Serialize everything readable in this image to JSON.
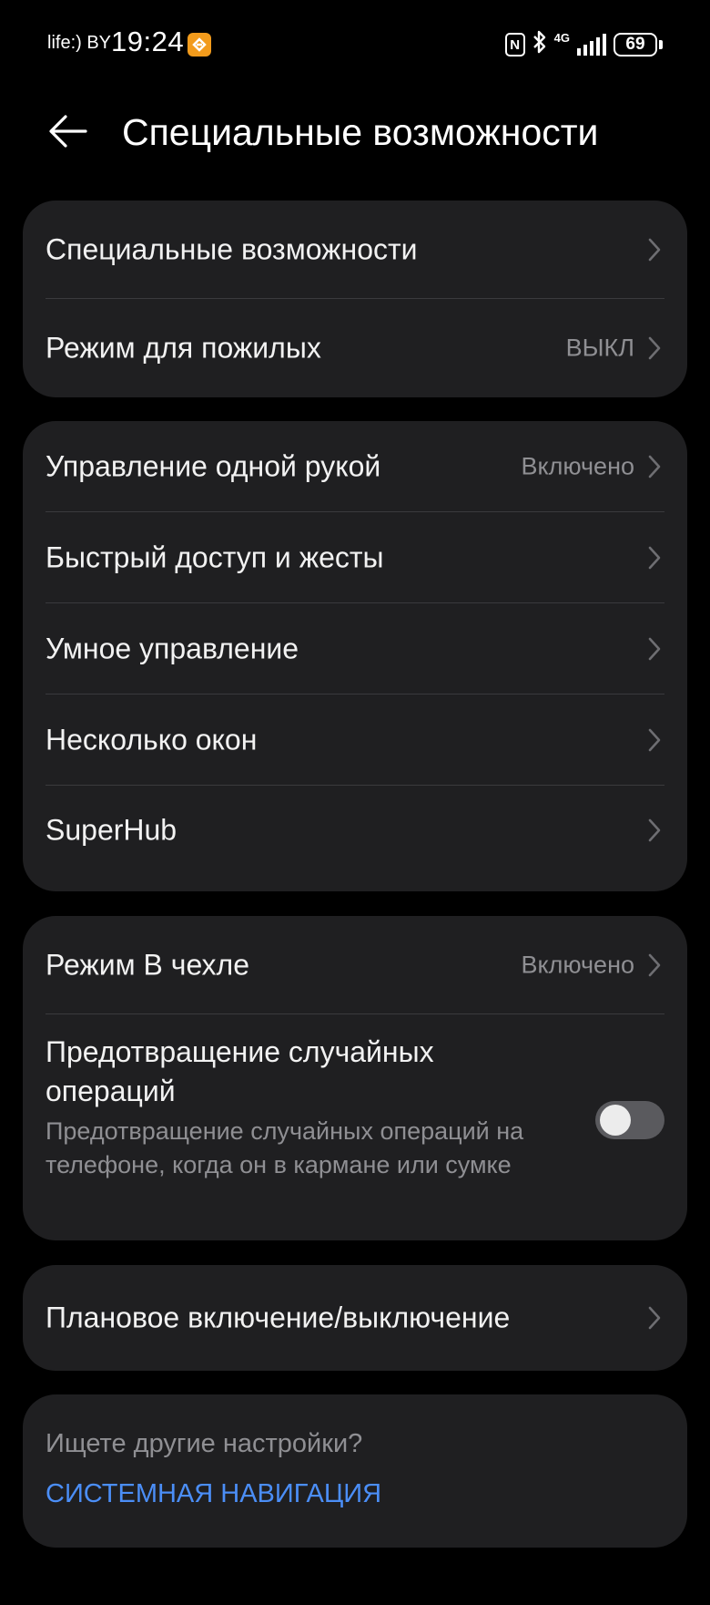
{
  "status_bar": {
    "carrier": "life:) BY",
    "time": "19:24",
    "network": "4G",
    "battery": "69"
  },
  "header": {
    "title": "Специальные возможности"
  },
  "group1": [
    {
      "label": "Специальные возможности",
      "value": ""
    },
    {
      "label": "Режим для пожилых",
      "value": "ВЫКЛ"
    }
  ],
  "group2": [
    {
      "label": "Управление одной рукой",
      "value": "Включено"
    },
    {
      "label": "Быстрый доступ и жесты",
      "value": ""
    },
    {
      "label": "Умное управление",
      "value": ""
    },
    {
      "label": "Несколько окон",
      "value": ""
    },
    {
      "label": "SuperHub",
      "value": ""
    }
  ],
  "group3": {
    "case_mode": {
      "label": "Режим В чехле",
      "value": "Включено"
    },
    "accidental": {
      "title": "Предотвращение случайных операций",
      "description": "Предотвращение случайных операций на телефоне, когда он в кармане или сумке",
      "enabled": false
    }
  },
  "group4": [
    {
      "label": "Плановое включение/выключение",
      "value": ""
    }
  ],
  "search": {
    "question": "Ищете другие настройки?",
    "link": "СИСТЕМНАЯ НАВИГАЦИЯ"
  }
}
